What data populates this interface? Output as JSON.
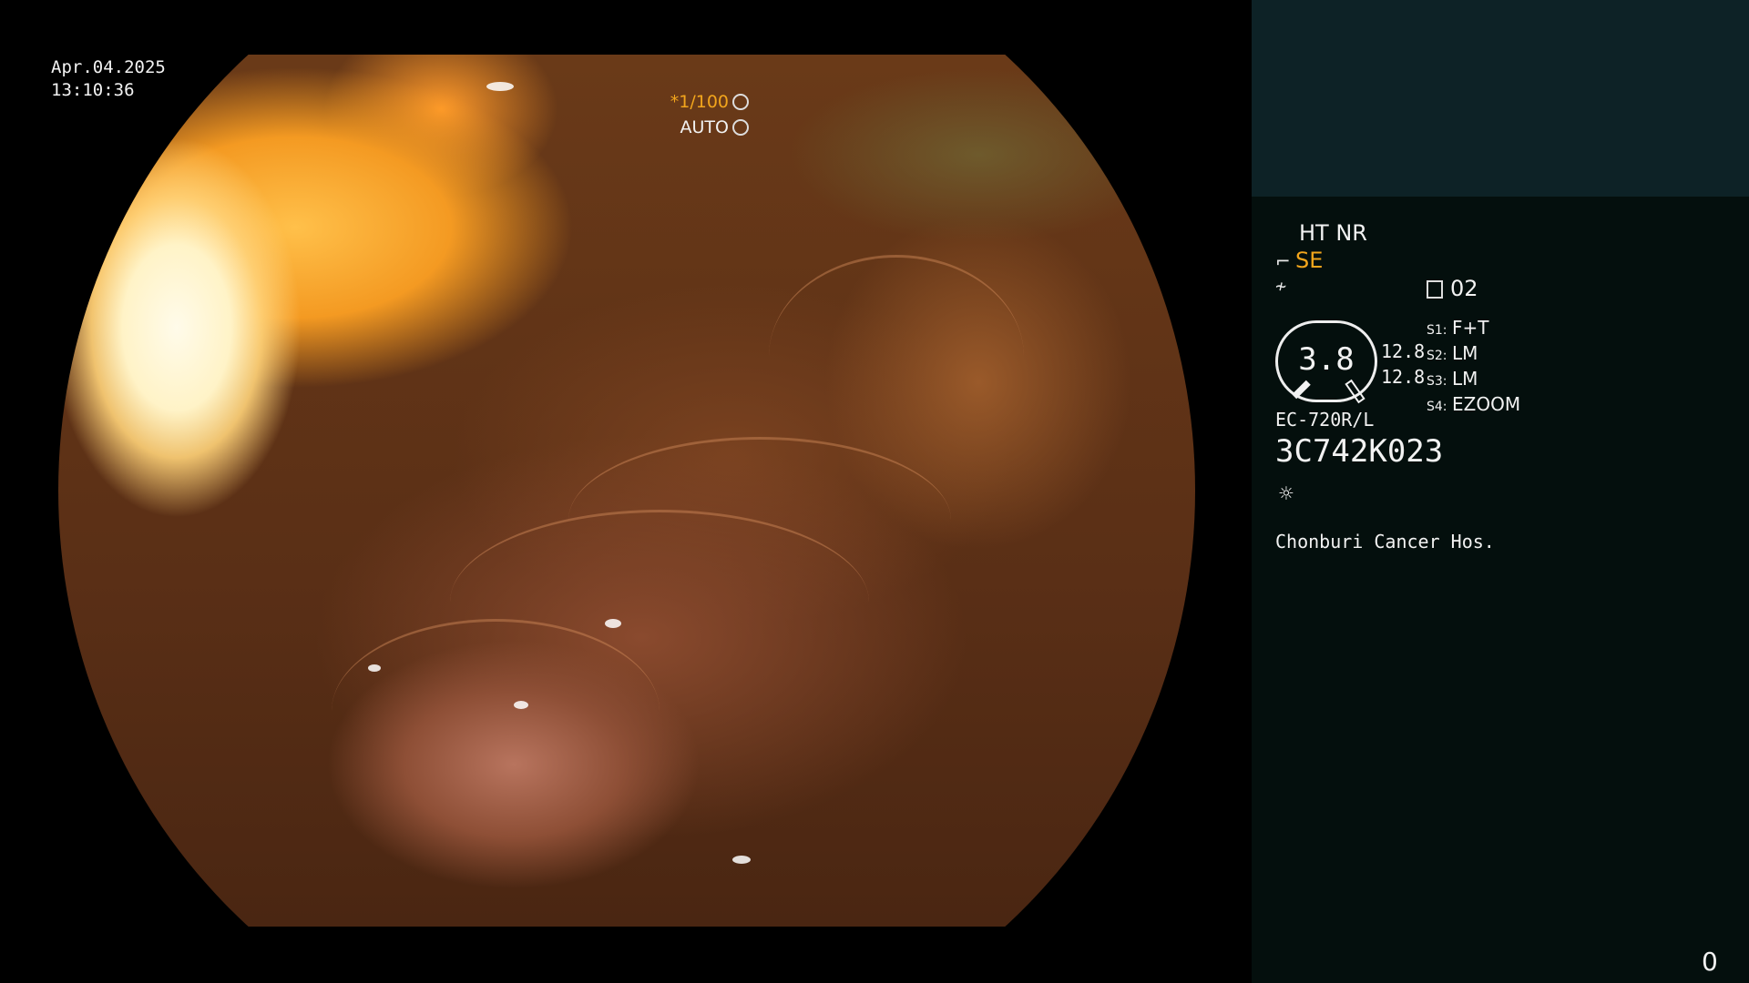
{
  "overlay": {
    "date": "Apr.04.2025",
    "time": "13:10:36",
    "shutter": "*1/100",
    "iris_mode": "AUTO"
  },
  "panel": {
    "enhancement": "HT NR",
    "structure_mode": "SE",
    "memory_count": "02",
    "gauge_value": "3.8",
    "readings": [
      "12.8",
      "12.8"
    ],
    "switches": [
      {
        "key": "S1:",
        "value": "F+T"
      },
      {
        "key": "S2:",
        "value": "LM"
      },
      {
        "key": "S3:",
        "value": "LM"
      },
      {
        "key": "S4:",
        "value": "EZOOM"
      }
    ],
    "scope_model": "EC-720R/L",
    "scope_serial": "3C742K023",
    "hospital": "Chonburi Cancer Hos.",
    "counter": "0"
  },
  "colors": {
    "accent_amber": "#f2a51c",
    "panel_top": "#0d2226",
    "panel_bg": "#040f0d"
  }
}
